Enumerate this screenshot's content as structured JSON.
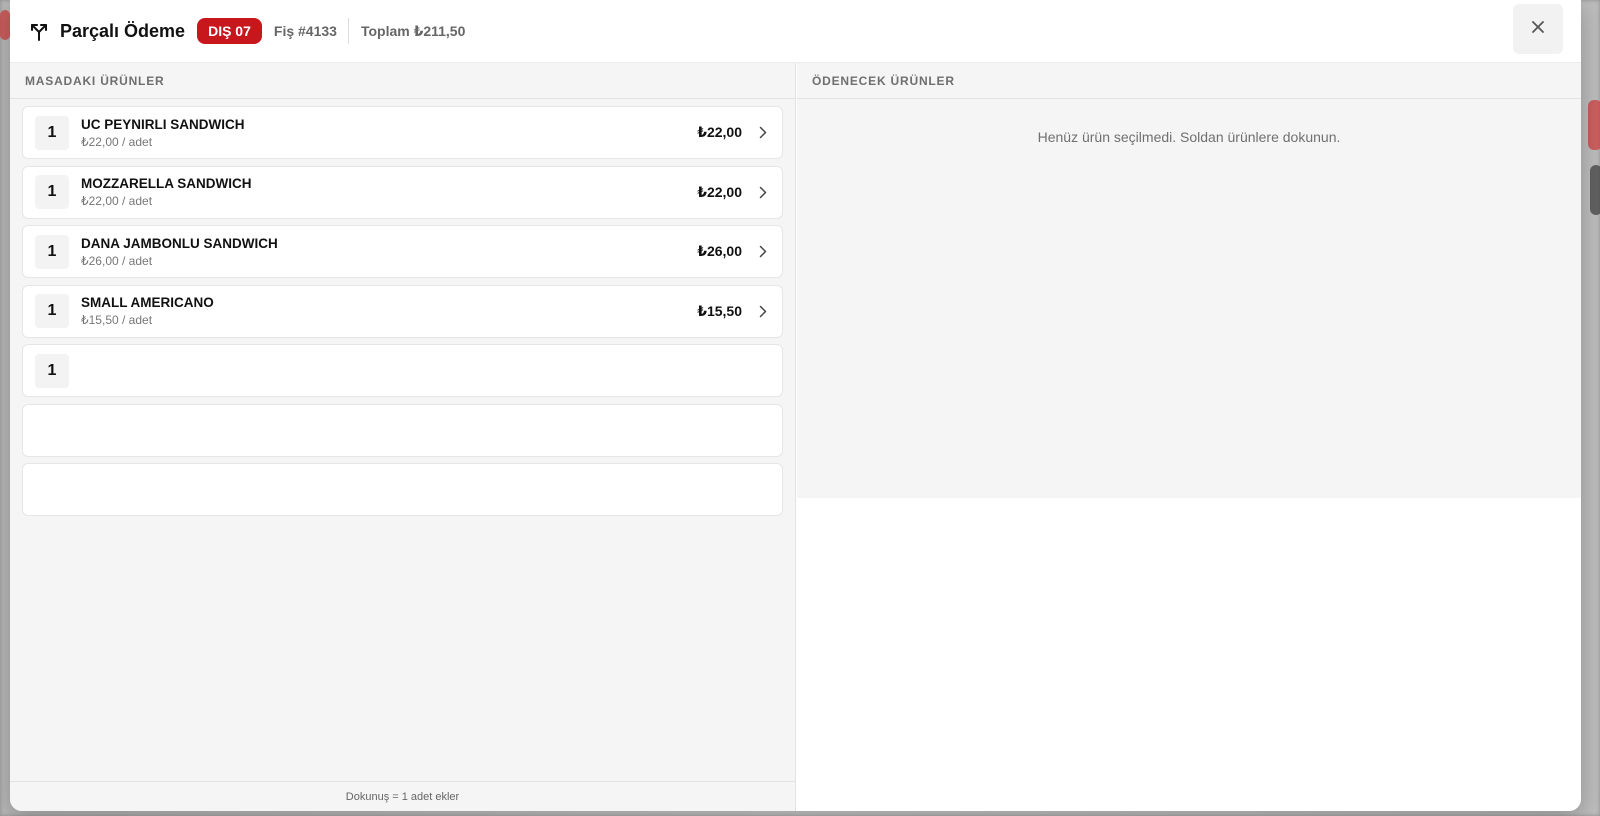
{
  "header": {
    "title": "Parçalı Ödeme",
    "table_badge": "DIŞ 07",
    "receipt": "Fiş #4133",
    "total": "Toplam ₺211,50"
  },
  "left_pane": {
    "heading": "MASADAKI ÜRÜNLER",
    "items": [
      {
        "qty": "1",
        "name": "UC PEYNIRLI SANDWICH",
        "unit": "₺22,00 / adet",
        "price": "₺22,00"
      },
      {
        "qty": "1",
        "name": "MOZZARELLA SANDWICH",
        "unit": "₺22,00 / adet",
        "price": "₺22,00"
      },
      {
        "qty": "1",
        "name": "DANA JAMBONLU SANDWICH",
        "unit": "₺26,00 / adet",
        "price": "₺26,00"
      },
      {
        "qty": "1",
        "name": "SMALL AMERICANO",
        "unit": "₺15,50 / adet",
        "price": "₺15,50"
      },
      {
        "qty": "1",
        "name": "",
        "unit": "",
        "price": ""
      },
      {
        "qty": "",
        "name": "",
        "unit": "",
        "price": ""
      },
      {
        "qty": "",
        "name": "",
        "unit": "",
        "price": ""
      }
    ],
    "footer": "Dokunuş = 1 adet ekler"
  },
  "right_pane": {
    "heading": "ÖDENECEK ÜRÜNLER",
    "empty_message": "Henüz ürün seçilmedi. Soldan ürünlere dokunun."
  },
  "colors": {
    "accent": "#c8161d",
    "pane_bg": "#f5f5f5"
  },
  "icons": {
    "header": "split-arrows-icon",
    "close": "close-icon",
    "row": "chevron-right-icon"
  }
}
